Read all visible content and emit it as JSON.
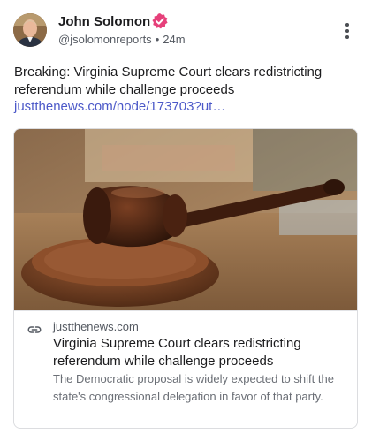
{
  "author": {
    "name": "John Solomon",
    "handle": "@jsolomonreports",
    "separator": "•",
    "time": "24m",
    "verified_icon": "verified-badge-icon",
    "verified_color": "#e6407a"
  },
  "post": {
    "text": "Breaking: Virginia Supreme Court clears redistricting referendum while challenge proceeds",
    "link": "justthenews.com/node/173703?ut…"
  },
  "card": {
    "image": "gavel-photo",
    "icon": "link-icon",
    "domain": "justthenews.com",
    "title": "Virginia Supreme Court clears redistricting referendum while challenge proceeds",
    "description": "The Democratic proposal is widely expected to shift the state's congressional delegation in favor of that party."
  },
  "colors": {
    "link": "#4b58c8",
    "text": "#1c1c1e",
    "muted": "#555a62"
  }
}
